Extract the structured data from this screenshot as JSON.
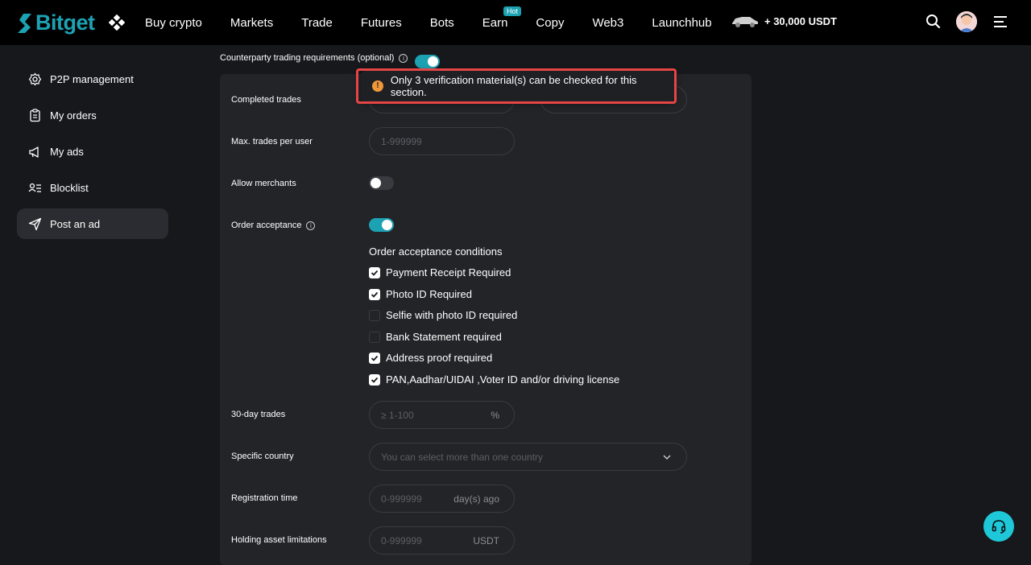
{
  "brand": {
    "name": "Bitget",
    "accent": "#1da2b4"
  },
  "nav": {
    "items": [
      "Buy crypto",
      "Markets",
      "Trade",
      "Futures",
      "Bots",
      "Earn",
      "Copy",
      "Web3",
      "Launchhub"
    ],
    "badge": "Hot",
    "promo": "+ 30,000 USDT"
  },
  "sidebar": {
    "items": [
      {
        "label": "P2P management",
        "icon": "gear-icon"
      },
      {
        "label": "My orders",
        "icon": "clipboard-icon"
      },
      {
        "label": "My ads",
        "icon": "megaphone-icon"
      },
      {
        "label": "Blocklist",
        "icon": "user-list-icon"
      },
      {
        "label": "Post an ad",
        "icon": "send-icon"
      }
    ]
  },
  "form": {
    "counterparty_label": "Counterparty trading requirements (optional)",
    "counterparty_toggle": "on",
    "completed_trades_label": "Completed trades",
    "max_trades_label": "Max. trades per user",
    "max_trades_placeholder": "1-999999",
    "allow_merchants_label": "Allow merchants",
    "allow_merchants_toggle": "off",
    "order_acceptance_label": "Order acceptance",
    "order_acceptance_toggle": "on",
    "conditions_title": "Order acceptance conditions",
    "conditions": [
      {
        "label": "Payment Receipt Required",
        "checked": true
      },
      {
        "label": "Photo ID Required",
        "checked": true
      },
      {
        "label": "Selfie with photo ID required",
        "checked": false
      },
      {
        "label": "Bank Statement required",
        "checked": false
      },
      {
        "label": "Address proof required",
        "checked": true
      },
      {
        "label": "PAN,Aadhar/UIDAI ,Voter ID and/or driving license",
        "checked": true
      }
    ],
    "thirty_day_label": "30-day trades",
    "thirty_day_placeholder": "≥ 1-100",
    "thirty_day_suffix": "%",
    "country_label": "Specific country",
    "country_placeholder": "You can select more than one country",
    "registration_label": "Registration time",
    "registration_placeholder": "0-999999",
    "registration_suffix": "day(s) ago",
    "holding_label": "Holding asset limitations",
    "holding_placeholder": "0-999999",
    "holding_suffix": "USDT"
  },
  "toast": {
    "message": "Only 3 verification material(s) can be checked for this section.",
    "icon": "warning-icon",
    "highlight_color": "#e64545"
  }
}
